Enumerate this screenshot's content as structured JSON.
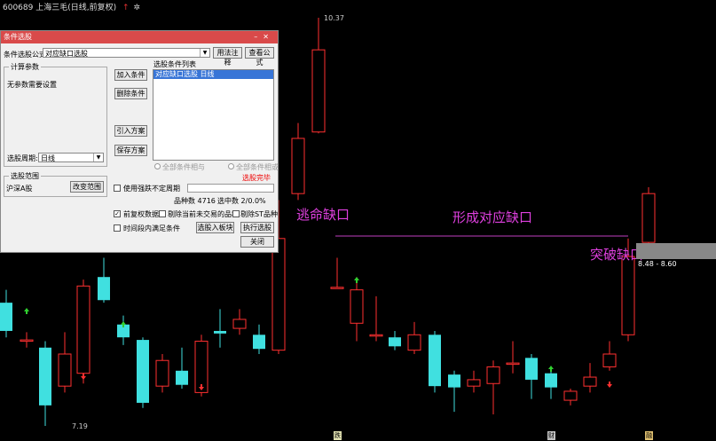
{
  "window": {
    "title": "600689 上海三毛(日线,前复权)",
    "up_arrow": "↑",
    "gear": "✲",
    "time_labels": [
      "",
      "",
      ""
    ]
  },
  "dialog": {
    "title": "条件选股",
    "formula_label": "条件选股公式",
    "formula_value": "对应缺口选股",
    "btn_usage": "用法注释",
    "btn_view": "查看公式",
    "calc_params_title": "计算参数",
    "no_params": "无参数需要设置",
    "list_title": "选股条件列表",
    "list_item": "对应缺口选股  日线",
    "btn_add": "加入条件",
    "btn_del": "删除条件",
    "btn_import": "引入方案",
    "btn_save": "保存方案",
    "radio_and": "全部条件相与",
    "radio_or": "全部条件相或",
    "period_label": "选股周期:",
    "period_value": "日线",
    "scope_title": "选股范围",
    "scope_value": "沪深A股",
    "btn_scope": "改变范围",
    "pick_done": "选股完毕",
    "use_custom_range": "使用强跌不定周期",
    "stock_count": "品种数 4716",
    "selected_count": "选中数 2/0.0%",
    "check_prev_adj": "前复权数据",
    "check_exclude_suspended": "剔除当前未交易的品种",
    "check_exclude_st": "剔除ST品种",
    "check_time_period": "时间段内满足条件",
    "btn_to_block": "选股入板块",
    "btn_execute": "执行选股",
    "btn_close": "关闭"
  },
  "annotations": {
    "escape_gap": "逃命缺口",
    "form_gap": "形成对应缺口",
    "breakout_gap": "突破缺口"
  },
  "price": {
    "high_label": "10.37",
    "low_label": "7.19",
    "range_label": "8.48 - 8.60"
  },
  "axis_markers": [
    {
      "label": "跌",
      "color": "#e0e0b0"
    },
    {
      "label": "财",
      "color": "#c0c0c0"
    },
    {
      "label": "融",
      "color": "#e0c070"
    }
  ],
  "colors": {
    "up": "#ff3030",
    "down": "#40e0e0",
    "annotation": "#e040e0",
    "gap_line": "#c040c0",
    "dialog_title": "#d94a4a"
  },
  "chart_data": {
    "type": "candlestick",
    "price_high": 10.37,
    "price_low": 7.19,
    "candles": [
      {
        "o": 8.15,
        "c": 7.93,
        "h": 8.25,
        "l": 7.88
      },
      {
        "o": 7.85,
        "c": 7.86,
        "h": 7.92,
        "l": 7.8
      },
      {
        "o": 7.8,
        "c": 7.35,
        "h": 7.85,
        "l": 7.19
      },
      {
        "o": 7.5,
        "c": 7.75,
        "h": 7.92,
        "l": 7.45
      },
      {
        "o": 7.6,
        "c": 8.28,
        "h": 8.33,
        "l": 7.52
      },
      {
        "o": 8.35,
        "c": 8.17,
        "h": 8.5,
        "l": 8.15
      },
      {
        "o": 7.98,
        "c": 7.88,
        "h": 8.05,
        "l": 7.82
      },
      {
        "o": 7.86,
        "c": 7.37,
        "h": 7.88,
        "l": 7.33
      },
      {
        "o": 7.5,
        "c": 7.7,
        "h": 7.75,
        "l": 7.45
      },
      {
        "o": 7.62,
        "c": 7.51,
        "h": 7.8,
        "l": 7.48
      },
      {
        "o": 7.45,
        "c": 7.85,
        "h": 7.9,
        "l": 7.42
      },
      {
        "o": 7.93,
        "c": 7.91,
        "h": 8.1,
        "l": 7.8
      },
      {
        "o": 7.95,
        "c": 8.02,
        "h": 8.1,
        "l": 7.9
      },
      {
        "o": 7.9,
        "c": 7.79,
        "h": 7.98,
        "l": 7.75
      },
      {
        "o": 7.78,
        "c": 8.65,
        "h": 8.95,
        "l": 7.75
      },
      {
        "o": 9.0,
        "c": 9.43,
        "h": 9.55,
        "l": 8.95
      },
      {
        "o": 9.48,
        "c": 10.12,
        "h": 10.37,
        "l": 9.47
      },
      {
        "o": 8.27,
        "c": 8.27,
        "h": 8.5,
        "l": 8.27
      },
      {
        "o": 7.99,
        "c": 8.25,
        "h": 8.35,
        "l": 7.85
      },
      {
        "o": 7.9,
        "c": 7.9,
        "h": 8.2,
        "l": 7.85
      },
      {
        "o": 7.88,
        "c": 7.81,
        "h": 7.93,
        "l": 7.78
      },
      {
        "o": 7.78,
        "c": 7.9,
        "h": 8.0,
        "l": 7.75
      },
      {
        "o": 7.9,
        "c": 7.5,
        "h": 7.93,
        "l": 7.45
      },
      {
        "o": 7.59,
        "c": 7.49,
        "h": 7.62,
        "l": 7.3
      },
      {
        "o": 7.5,
        "c": 7.55,
        "h": 7.62,
        "l": 7.45
      },
      {
        "o": 7.52,
        "c": 7.65,
        "h": 7.7,
        "l": 7.28
      },
      {
        "o": 7.68,
        "c": 7.68,
        "h": 7.85,
        "l": 7.6
      },
      {
        "o": 7.72,
        "c": 7.55,
        "h": 7.75,
        "l": 7.4
      },
      {
        "o": 7.6,
        "c": 7.49,
        "h": 7.65,
        "l": 7.4
      },
      {
        "o": 7.39,
        "c": 7.46,
        "h": 7.48,
        "l": 7.35
      },
      {
        "o": 7.5,
        "c": 7.57,
        "h": 7.68,
        "l": 7.45
      },
      {
        "o": 7.65,
        "c": 7.75,
        "h": 7.85,
        "l": 7.62
      },
      {
        "o": 7.9,
        "c": 8.51,
        "h": 8.65,
        "l": 7.85
      },
      {
        "o": 8.62,
        "c": 9.0,
        "h": 9.05,
        "l": 8.6
      }
    ]
  }
}
